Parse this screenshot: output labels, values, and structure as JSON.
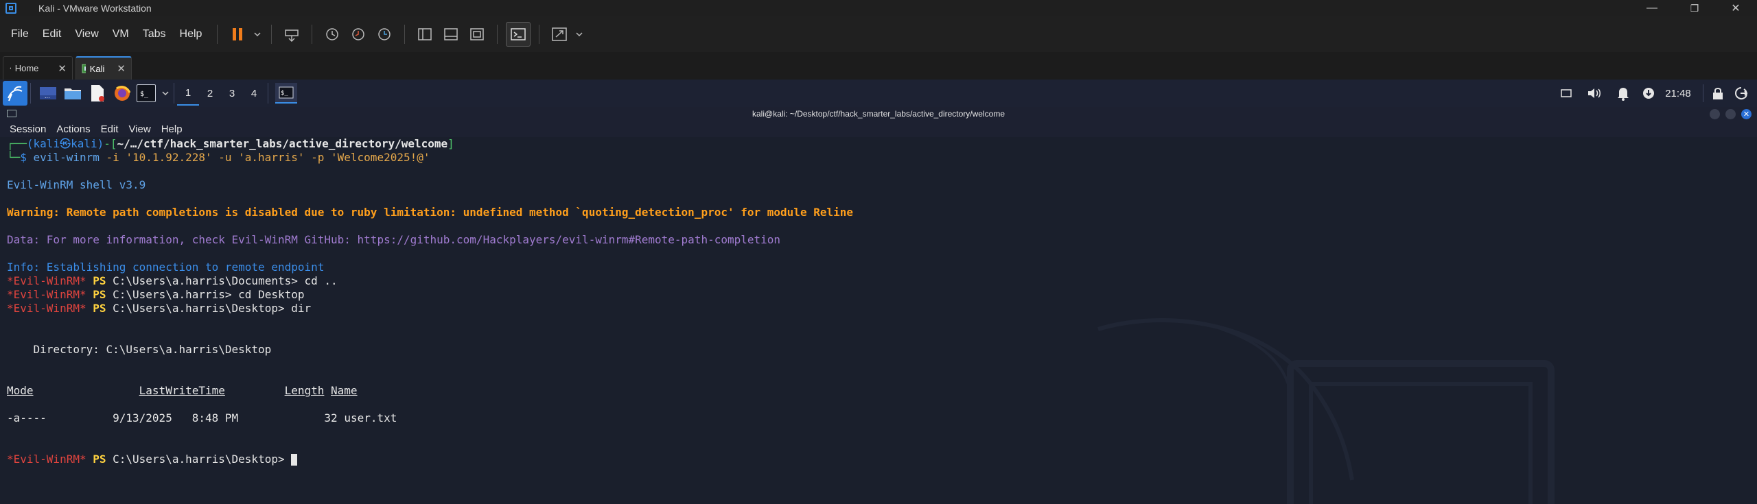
{
  "window": {
    "title": "Kali - VMware Workstation",
    "min": "—",
    "max": "❐",
    "close": "✕"
  },
  "menubar": {
    "items": [
      {
        "label": "File"
      },
      {
        "label": "Edit"
      },
      {
        "label": "View"
      },
      {
        "label": "VM"
      },
      {
        "label": "Tabs"
      },
      {
        "label": "Help"
      }
    ]
  },
  "tabs": [
    {
      "label": "Home",
      "close": "✕",
      "icon": "home-icon"
    },
    {
      "label": "Kali",
      "close": "✕",
      "icon": "vm-icon",
      "active": true
    }
  ],
  "panel": {
    "workspaces": [
      "1",
      "2",
      "3",
      "4"
    ],
    "clock": "21:48"
  },
  "terminal": {
    "title": "kali@kali: ~/Desktop/ctf/hack_smarter_labs/active_directory/welcome",
    "menu": [
      "Session",
      "Actions",
      "Edit",
      "View",
      "Help"
    ],
    "prompt": {
      "user_host": "(kali㉿kali)",
      "path": "~/…/ctf/hack_smarter_labs/active_directory/welcome",
      "command_name": "evil-winrm",
      "command_args": " -i '10.1.92.228' -u 'a.harris' -p 'Welcome2025!@'"
    },
    "banner": "Evil-WinRM shell v3.9",
    "warning": "Warning: Remote path completions is disabled due to ruby limitation: undefined method `quoting_detection_proc' for module Reline",
    "data_line": "Data: For more information, check Evil-WinRM GitHub: https://github.com/Hackplayers/evil-winrm#Remote-path-completion",
    "info_line": "Info: Establishing connection to remote endpoint",
    "ps_prefix": "*Evil-WinRM*",
    "ps_label": "PS",
    "ps_lines": [
      "C:\\Users\\a.harris\\Documents> cd ..",
      "C:\\Users\\a.harris> cd Desktop",
      "C:\\Users\\a.harris\\Desktop> dir"
    ],
    "directory_line": "    Directory: C:\\Users\\a.harris\\Desktop",
    "table_headers": {
      "mode": "Mode",
      "lwt": "LastWriteTime",
      "length": "Length",
      "name": "Name"
    },
    "table_row": {
      "mode": "-a----",
      "date": "9/13/2025",
      "time": "8:48 PM",
      "length": "32",
      "name": "user.txt"
    },
    "final_prompt": "C:\\Users\\a.harris\\Desktop> "
  },
  "colors": {
    "accent": "#3a8ee6",
    "term_bg": "#1a1f2c",
    "ps_red": "#e0443e",
    "ps_yellow": "#ffd23f"
  }
}
